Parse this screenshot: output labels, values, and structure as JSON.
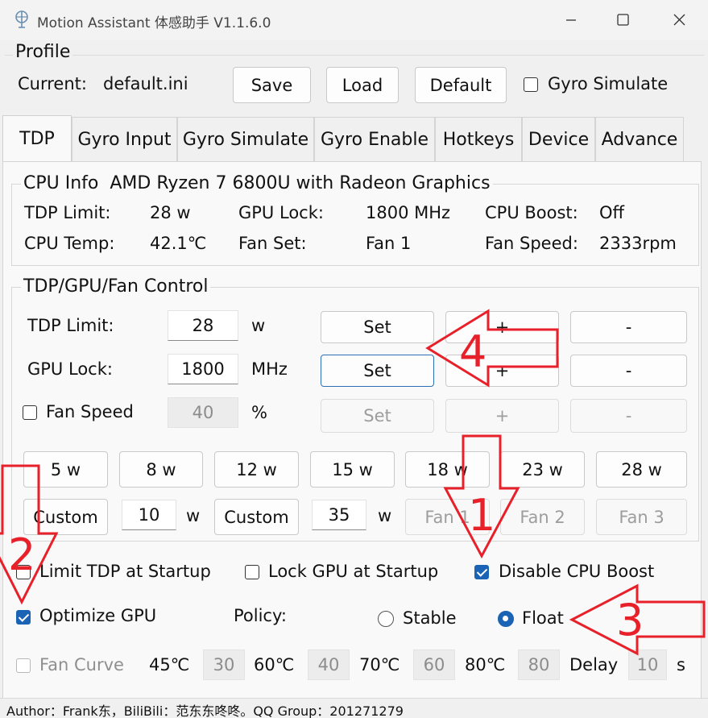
{
  "window": {
    "title": "Motion Assistant 体感助手 V1.1.6.0",
    "icons": [
      "app-logo-icon",
      "minimize-icon",
      "maximize-icon",
      "close-icon"
    ]
  },
  "profile": {
    "group_title": "Profile",
    "current_label": "Current:",
    "current_value": "default.ini",
    "save_label": "Save",
    "load_label": "Load",
    "default_label": "Default",
    "gyro_simulate_label": "Gyro Simulate",
    "gyro_simulate_checked": false
  },
  "tabs": [
    {
      "label": "TDP",
      "active": true
    },
    {
      "label": "Gyro Input",
      "active": false
    },
    {
      "label": "Gyro Simulate",
      "active": false
    },
    {
      "label": "Gyro Enable",
      "active": false
    },
    {
      "label": "Hotkeys",
      "active": false
    },
    {
      "label": "Device",
      "active": false
    },
    {
      "label": "Advance",
      "active": false
    }
  ],
  "cpu_info": {
    "title": "CPU Info",
    "cpu_name": "AMD Ryzen 7 6800U with Radeon Graphics",
    "tdp_limit_label": "TDP Limit:",
    "tdp_limit_value": "28 w",
    "gpu_lock_label": "GPU Lock:",
    "gpu_lock_value": "1800 MHz",
    "cpu_boost_label": "CPU Boost:",
    "cpu_boost_value": "Off",
    "cpu_temp_label": "CPU Temp:",
    "cpu_temp_value": "42.1℃",
    "fan_set_label": "Fan Set:",
    "fan_set_value": "Fan 1",
    "fan_speed_label": "Fan Speed:",
    "fan_speed_value": "2333rpm"
  },
  "control": {
    "title": "TDP/GPU/Fan Control",
    "tdp_label": "TDP Limit:",
    "tdp_value": "28",
    "tdp_unit": "w",
    "gpu_label": "GPU Lock:",
    "gpu_value": "1800",
    "gpu_unit": "MHz",
    "fan_label": "Fan Speed",
    "fan_checked": false,
    "fan_value": "40",
    "fan_unit": "%",
    "set_label": "Set",
    "plus_label": "+",
    "minus_label": "-",
    "presets": [
      "5 w",
      "8 w",
      "12 w",
      "15 w",
      "18 w",
      "23 w",
      "28 w"
    ],
    "custom1_label": "Custom",
    "custom1_value": "10",
    "custom1_unit": "w",
    "custom2_label": "Custom",
    "custom2_value": "35",
    "custom2_unit": "w",
    "fan_buttons": [
      "Fan 1",
      "Fan 2",
      "Fan 3"
    ]
  },
  "options": {
    "limit_tdp_label": "Limit TDP at Startup",
    "limit_tdp_checked": false,
    "lock_gpu_label": "Lock GPU at Startup",
    "lock_gpu_checked": false,
    "disable_boost_label": "Disable CPU Boost",
    "disable_boost_checked": true,
    "optimize_gpu_label": "Optimize GPU",
    "optimize_gpu_checked": true,
    "policy_label": "Policy:",
    "stable_label": "Stable",
    "float_label": "Float",
    "policy_selected": "Float",
    "fan_curve_label": "Fan Curve",
    "fan_curve_checked": false,
    "t1": "45℃",
    "v1": "30",
    "t2": "60℃",
    "v2": "40",
    "t3": "70℃",
    "v3": "60",
    "t4": "80℃",
    "v4": "80",
    "delay_label": "Delay",
    "delay_value": "10",
    "delay_unit": "s"
  },
  "status": {
    "text": "Author：Frank东，BiliBili：范东东咚咚。QQ Group：201271279"
  },
  "annotations": {
    "color": "#e8202a",
    "labels": [
      "1",
      "2",
      "3",
      "4"
    ]
  }
}
